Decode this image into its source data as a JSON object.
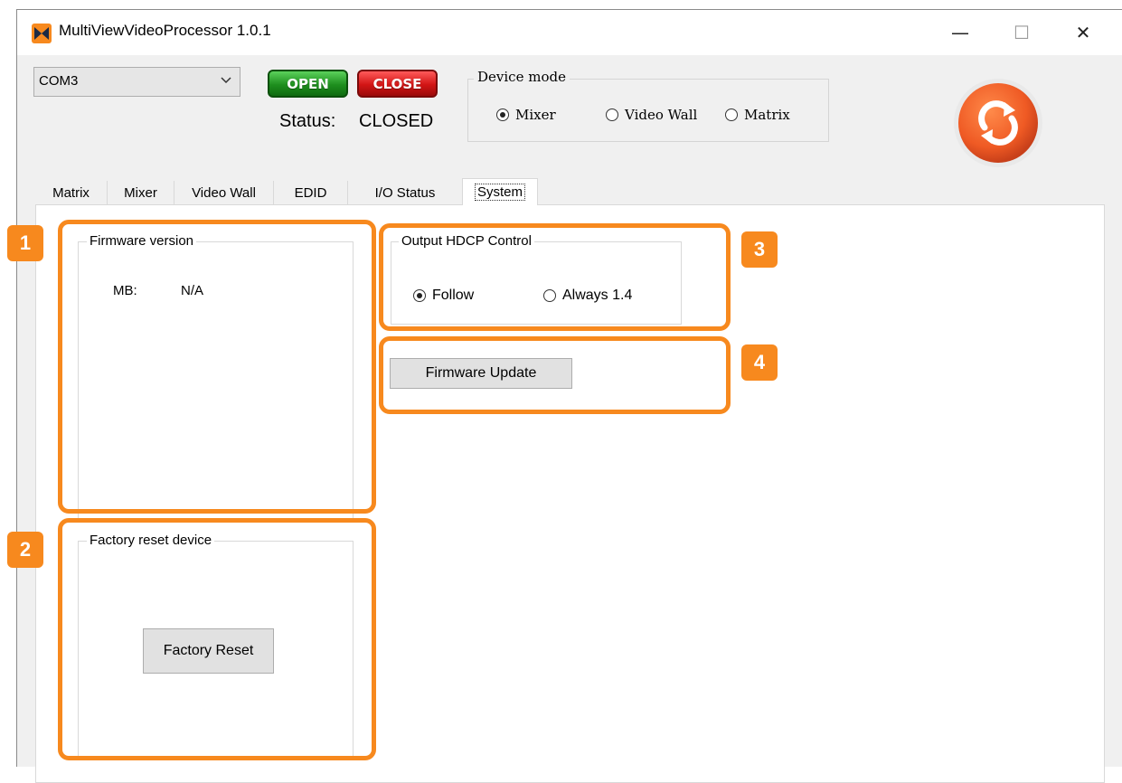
{
  "window": {
    "title": "MultiViewVideoProcessor 1.0.1",
    "minimize_glyph": "—",
    "maximize_glyph": "☐",
    "close_glyph": "✕"
  },
  "connection": {
    "port_selected": "COM3",
    "open_label": "OPEN",
    "close_label": "CLOSE",
    "status_label": "Status:",
    "status_value": "CLOSED"
  },
  "device_mode": {
    "legend": "Device mode",
    "options": [
      {
        "label": "Mixer",
        "checked": true
      },
      {
        "label": "Video Wall",
        "checked": false
      },
      {
        "label": "Matrix",
        "checked": false
      }
    ]
  },
  "tabs": [
    {
      "label": "Matrix"
    },
    {
      "label": "Mixer"
    },
    {
      "label": "Video Wall"
    },
    {
      "label": "EDID"
    },
    {
      "label": "I/O Status"
    },
    {
      "label": "System",
      "active": true
    }
  ],
  "system": {
    "firmware": {
      "legend": "Firmware version",
      "mb_label": "MB:",
      "mb_value": "N/A"
    },
    "factory": {
      "legend": "Factory reset device",
      "button": "Factory Reset"
    },
    "hdcp": {
      "legend": "Output HDCP Control",
      "options": [
        {
          "label": "Follow",
          "checked": true
        },
        {
          "label": "Always 1.4",
          "checked": false
        }
      ]
    },
    "update_button": "Firmware Update"
  },
  "callouts": [
    {
      "number": "1"
    },
    {
      "number": "2"
    },
    {
      "number": "3"
    },
    {
      "number": "4"
    }
  ],
  "colors": {
    "callout": "#f7891e",
    "open_button": "#1e8f1e",
    "close_button": "#d21515",
    "sync_button": "#ef5a24"
  },
  "icons": [
    "app-logo-icon",
    "chevron-down-icon",
    "sync-icon"
  ]
}
